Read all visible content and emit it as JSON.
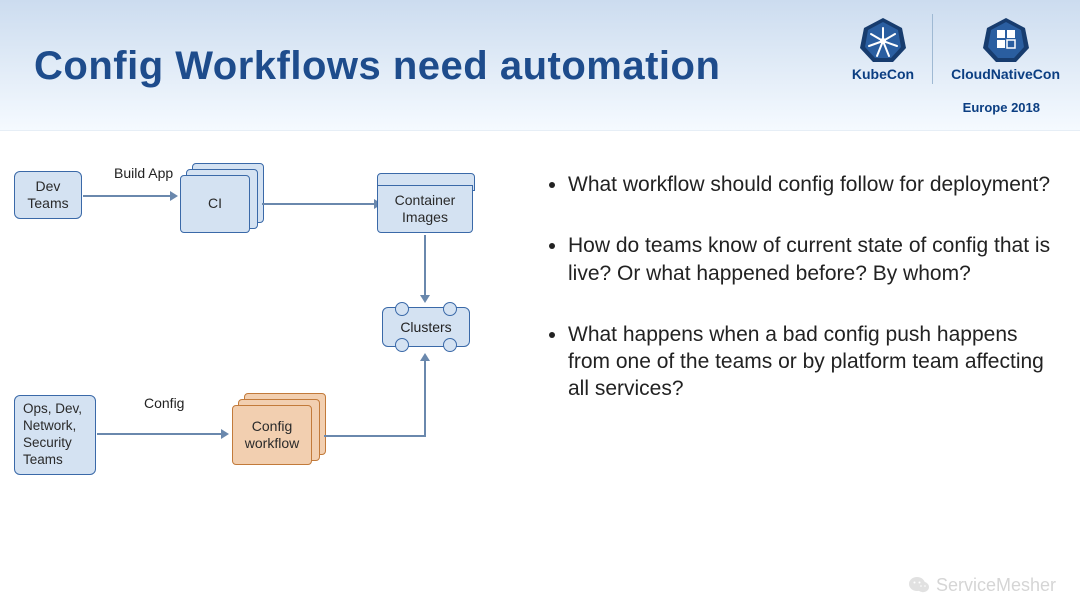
{
  "header": {
    "title": "Config Workflows need automation",
    "event_subline": "Europe 2018",
    "logos": {
      "left": {
        "label": "KubeCon"
      },
      "right": {
        "label": "CloudNativeCon"
      }
    }
  },
  "diagram": {
    "nodes": {
      "dev_teams": "Dev\nTeams",
      "ci": "CI",
      "container_images": "Container\nImages",
      "clusters": "Clusters",
      "ops_teams": "Ops, Dev,\nNetwork,\nSecurity\nTeams",
      "config_workflow": "Config\nworkflow"
    },
    "edge_labels": {
      "build_app": "Build App",
      "config": "Config"
    },
    "flows": [
      {
        "from": "dev_teams",
        "to": "ci",
        "label_key": "build_app"
      },
      {
        "from": "ci",
        "to": "container_images"
      },
      {
        "from": "container_images",
        "to": "clusters"
      },
      {
        "from": "ops_teams",
        "to": "config_workflow",
        "label_key": "config"
      },
      {
        "from": "config_workflow",
        "to": "clusters"
      }
    ]
  },
  "bullets": [
    "What workflow should config follow for deployment?",
    "How do teams know of current state of config that is live? Or what happened before? By whom?",
    "What happens when a bad config push happens from one of the teams or by platform team affecting all services?"
  ],
  "watermark": "ServiceMesher"
}
